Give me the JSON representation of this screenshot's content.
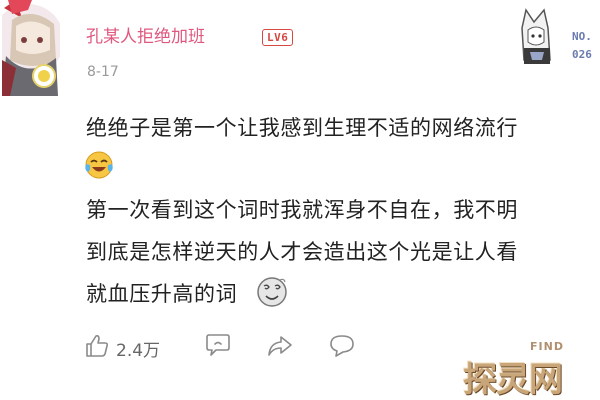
{
  "comment": {
    "author": "孔某人拒绝加班",
    "level_badge": "LV6",
    "date": "8-17",
    "body_lines": [
      "绝绝子是第一个让我感到生理不适的网络流行",
      "第一次看到这个词时我就浑身不自在，我不明",
      "到底是怎样逆天的人才会造出这个光是让人看",
      "就血压升高的词"
    ],
    "emojis": [
      "tears-of-laughter-emoji",
      "dizzy-sticker-emoji"
    ]
  },
  "fan_badge": {
    "label_top": "NO.",
    "label_bottom": "026"
  },
  "actions": {
    "like_count": "2.4万",
    "icons": [
      "thumbs-up-icon",
      "dislike-bubble-icon",
      "share-arrow-icon",
      "comment-bubble-icon"
    ]
  },
  "watermark": {
    "text": "探灵网",
    "subtext": "FIND"
  },
  "colors": {
    "username": "#e0587f",
    "level": "#d44a43",
    "icon_gray": "#8a8a8a",
    "watermark": "#c9a679"
  }
}
